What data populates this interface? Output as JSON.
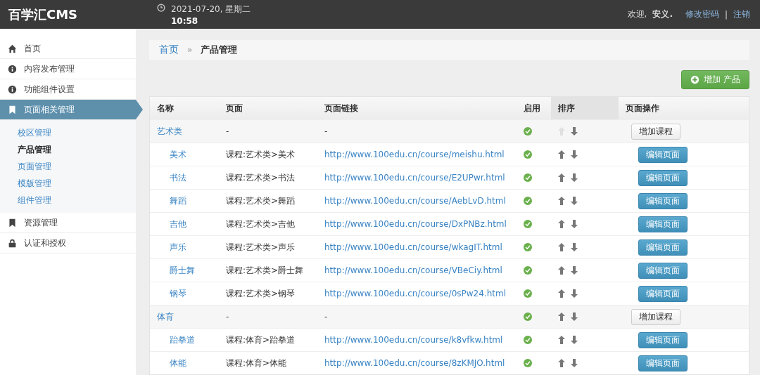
{
  "header": {
    "brand": "百学汇CMS",
    "date": "2021-07-20, 星期二",
    "time": "10:58",
    "welcome": "欢迎,",
    "user": "安义.",
    "change_password": "修改密码",
    "separator": "|",
    "logout": "注销"
  },
  "sidebar": {
    "items": [
      {
        "label": "首页",
        "kind": "home",
        "selected": false
      },
      {
        "label": "内容发布管理",
        "kind": "info",
        "selected": false
      },
      {
        "label": "功能组件设置",
        "kind": "info",
        "selected": false
      },
      {
        "label": "页面相关管理",
        "kind": "bookmark",
        "selected": true,
        "children": [
          {
            "label": "校区管理",
            "selected": false
          },
          {
            "label": "产品管理",
            "selected": true
          },
          {
            "label": "页面管理",
            "selected": false
          },
          {
            "label": "模版管理",
            "selected": false
          },
          {
            "label": "组件管理",
            "selected": false
          }
        ]
      },
      {
        "label": "资源管理",
        "kind": "bookmark",
        "selected": false
      },
      {
        "label": "认证和授权",
        "kind": "lock",
        "selected": false
      }
    ]
  },
  "breadcrumb": {
    "home": "首页",
    "separator": "»",
    "current": "产品管理"
  },
  "add_button": "增加 产品",
  "table": {
    "columns": [
      "名称",
      "页面",
      "页面链接",
      "启用",
      "排序",
      "页面操作"
    ],
    "rows": [
      {
        "kind": "category",
        "name": "艺术类",
        "page": "-",
        "link": "-",
        "enabled": true,
        "up_disabled": true,
        "action": "增加课程"
      },
      {
        "kind": "course",
        "name": "美术",
        "page": "课程:艺术类>美术",
        "link": "http://www.100edu.cn/course/meishu.html",
        "enabled": true,
        "up_disabled": false,
        "action": "编辑页面"
      },
      {
        "kind": "course",
        "name": "书法",
        "page": "课程:艺术类>书法",
        "link": "http://www.100edu.cn/course/E2UPwr.html",
        "enabled": true,
        "up_disabled": false,
        "action": "编辑页面"
      },
      {
        "kind": "course",
        "name": "舞蹈",
        "page": "课程:艺术类>舞蹈",
        "link": "http://www.100edu.cn/course/AebLvD.html",
        "enabled": true,
        "up_disabled": false,
        "action": "编辑页面"
      },
      {
        "kind": "course",
        "name": "吉他",
        "page": "课程:艺术类>吉他",
        "link": "http://www.100edu.cn/course/DxPNBz.html",
        "enabled": true,
        "up_disabled": false,
        "action": "编辑页面"
      },
      {
        "kind": "course",
        "name": "声乐",
        "page": "课程:艺术类>声乐",
        "link": "http://www.100edu.cn/course/wkagIT.html",
        "enabled": true,
        "up_disabled": false,
        "action": "编辑页面"
      },
      {
        "kind": "course",
        "name": "爵士舞",
        "page": "课程:艺术类>爵士舞",
        "link": "http://www.100edu.cn/course/VBeCiy.html",
        "enabled": true,
        "up_disabled": false,
        "action": "编辑页面"
      },
      {
        "kind": "course",
        "name": "钢琴",
        "page": "课程:艺术类>钢琴",
        "link": "http://www.100edu.cn/course/0sPw24.html",
        "enabled": true,
        "up_disabled": false,
        "action": "编辑页面"
      },
      {
        "kind": "category",
        "name": "体育",
        "page": "-",
        "link": "-",
        "enabled": true,
        "up_disabled": false,
        "action": "增加课程"
      },
      {
        "kind": "course",
        "name": "跆拳道",
        "page": "课程:体育>跆拳道",
        "link": "http://www.100edu.cn/course/k8vfkw.html",
        "enabled": true,
        "up_disabled": false,
        "action": "编辑页面"
      },
      {
        "kind": "course",
        "name": "体能",
        "page": "课程:体育>体能",
        "link": "http://www.100edu.cn/course/8zKMJO.html",
        "enabled": true,
        "up_disabled": false,
        "action": "编辑页面"
      }
    ]
  }
}
